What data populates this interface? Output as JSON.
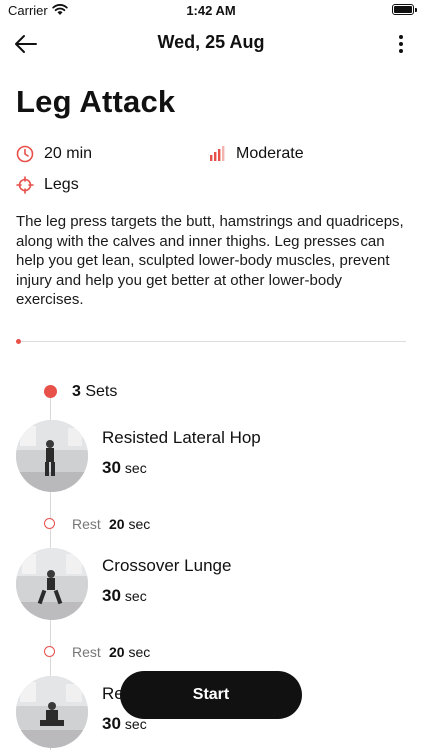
{
  "status_bar": {
    "carrier": "Carrier",
    "time": "1:42 AM"
  },
  "nav": {
    "title": "Wed, 25 Aug"
  },
  "workout": {
    "title": "Leg Attack",
    "duration": "20 min",
    "level": "Moderate",
    "focus": "Legs",
    "description": "The leg press targets the butt, hamstrings and quadriceps, along with the calves and inner thighs. Leg presses can help you get lean, sculpted lower-body muscles, prevent injury and help you get better at other lower-body exercises."
  },
  "sets": {
    "count": "3",
    "label": "Sets"
  },
  "exercises": [
    {
      "name": "Resisted Lateral Hop",
      "duration_value": "30",
      "duration_unit": "sec"
    },
    {
      "name": "Crossover Lunge",
      "duration_value": "30",
      "duration_unit": "sec"
    },
    {
      "name": "Re",
      "duration_value": "30",
      "duration_unit": "sec"
    }
  ],
  "rests": [
    {
      "label": "Rest",
      "value": "20",
      "unit": "sec"
    },
    {
      "label": "Rest",
      "value": "20",
      "unit": "sec"
    }
  ],
  "actions": {
    "start_label": "Start"
  },
  "colors": {
    "accent": "#e8504a",
    "button": "#111111",
    "muted": "#777777"
  },
  "icons": {
    "back": "arrow-left-icon",
    "more": "more-vertical-icon",
    "duration": "clock-icon",
    "level": "bar-chart-icon",
    "focus": "crosshair-icon"
  }
}
